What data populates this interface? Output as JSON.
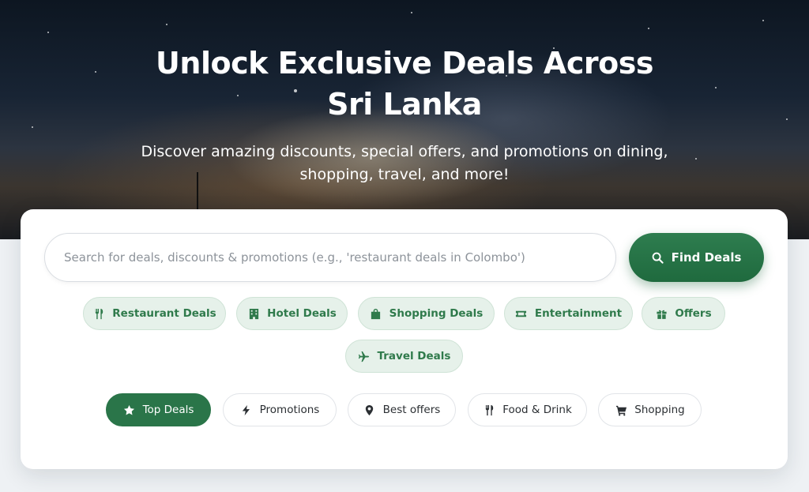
{
  "hero": {
    "title_line1": "Unlock Exclusive Deals Across",
    "title_line2": "Sri Lanka",
    "subtitle_line1": "Discover amazing discounts, special offers, and promotions on dining,",
    "subtitle_line2": "shopping, travel, and more!"
  },
  "search": {
    "placeholder": "Search for deals, discounts & promotions (e.g., 'restaurant deals in Colombo')",
    "button_label": "Find Deals"
  },
  "categories": [
    {
      "label": "Restaurant Deals",
      "icon": "utensils-icon"
    },
    {
      "label": "Hotel Deals",
      "icon": "hotel-icon"
    },
    {
      "label": "Shopping Deals",
      "icon": "shopping-bag-icon"
    },
    {
      "label": "Entertainment",
      "icon": "ticket-icon"
    },
    {
      "label": "Offers",
      "icon": "gift-icon"
    },
    {
      "label": "Travel Deals",
      "icon": "plane-icon"
    }
  ],
  "filters": [
    {
      "label": "Top Deals",
      "icon": "star-icon",
      "active": true
    },
    {
      "label": "Promotions",
      "icon": "bolt-icon",
      "active": false
    },
    {
      "label": "Best offers",
      "icon": "map-pin-icon",
      "active": false
    },
    {
      "label": "Food & Drink",
      "icon": "utensils-icon",
      "active": false
    },
    {
      "label": "Shopping",
      "icon": "cart-icon",
      "active": false
    }
  ],
  "colors": {
    "accent": "#2a7549",
    "chip_bg": "#e6f1ea",
    "chip_text": "#2f7a4b",
    "page_bg": "#eef1f4"
  }
}
